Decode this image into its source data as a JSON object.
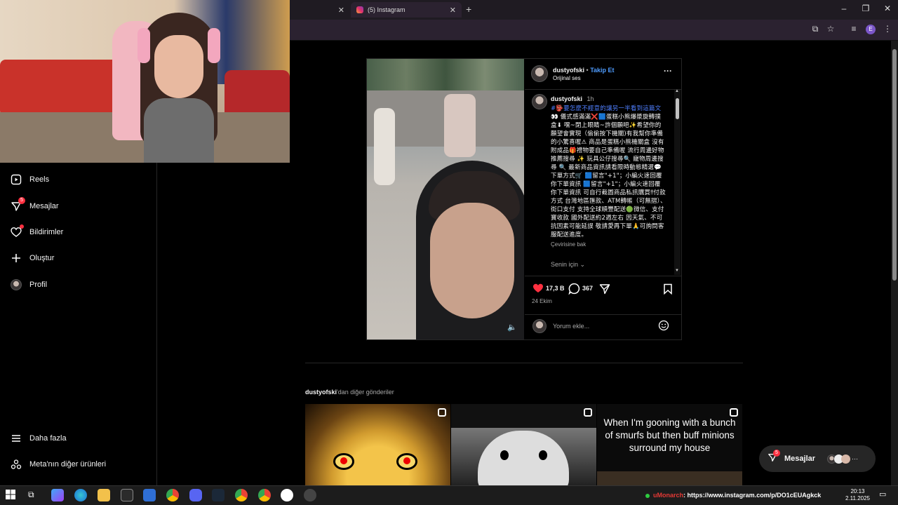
{
  "browser": {
    "tabs": [
      {
        "label": ""
      },
      {
        "label": "(5) Instagram"
      }
    ],
    "profile_initial": "E"
  },
  "sidebar": {
    "items": [
      {
        "label": "Reels",
        "icon": "reels-icon"
      },
      {
        "label": "Mesajlar",
        "icon": "messages-icon",
        "badge": "5"
      },
      {
        "label": "Bildirimler",
        "icon": "heart-icon"
      },
      {
        "label": "Oluştur",
        "icon": "plus-icon"
      },
      {
        "label": "Profil",
        "icon": "avatar"
      }
    ],
    "bottom": [
      {
        "label": "Daha fazla",
        "icon": "menu-icon"
      },
      {
        "label": "Meta'nın diğer ürünleri",
        "icon": "meta-icon"
      }
    ]
  },
  "post": {
    "username": "dustyofski",
    "follow": "Takip Et",
    "separator": "•",
    "audio": "Orijinal ses",
    "caption_user": "dustyofski",
    "caption_time": "1h",
    "caption_link": "#👺要怎麼不經意的讓另一半看到這篇文",
    "caption_text": "👀 儀式感滿滿❌🟦蛋糕小熊爆漿旋轉撲盒⬇ 嘿~閉上眼睛~許個願吧✨希望你的願望會實現（偷偷按下機關)有我幫你準備的小驚喜喔⚠ 商品是蛋糕小熊機關盒 沒有附成品🎁禮物要自己準備喔 流行周邊好物推薦搜尋 ✨ 玩具公仔搜尋🔍 寵物周邊搜尋 🔍 最新商品資訊請看限時動態精選💬 下單方式🛒 🟦留言\"+1\"；小編火速回覆你下單資訊 🟦留言\"+1\"；小編火速回覆你下單資訊 可自行截圖商品私訊購買‼付款方式 台灣地區匯款、ATM轉帳（可無摺）、街口支付 支持全球順豐配送🟢微信、支付寶收款 國外配送約2週左右 因天氣、不可抗因素可能延誤 敬請愛再下單🙏可詢問客服配送進度。",
    "translate": "Çevirisine bak",
    "for_you": "Senin için",
    "likes": "17,3 B",
    "comments": "367",
    "date": "24 Ekim",
    "comment_placeholder": "Yorum ekle..."
  },
  "more": {
    "user": "dustyofski",
    "suffix": "'dan diğer gönderiler",
    "thumb3_text": "When I'm gooning with a bunch of smurfs but then buff minions surround my house"
  },
  "float": {
    "label": "Mesajlar",
    "badge": "5"
  },
  "taskbar": {
    "ticker_name": "uMonarch",
    "ticker_text": ": https://www.instagram.com/p/DO1cEUAgkck",
    "time": "20:13",
    "date": "2.11.2025"
  }
}
